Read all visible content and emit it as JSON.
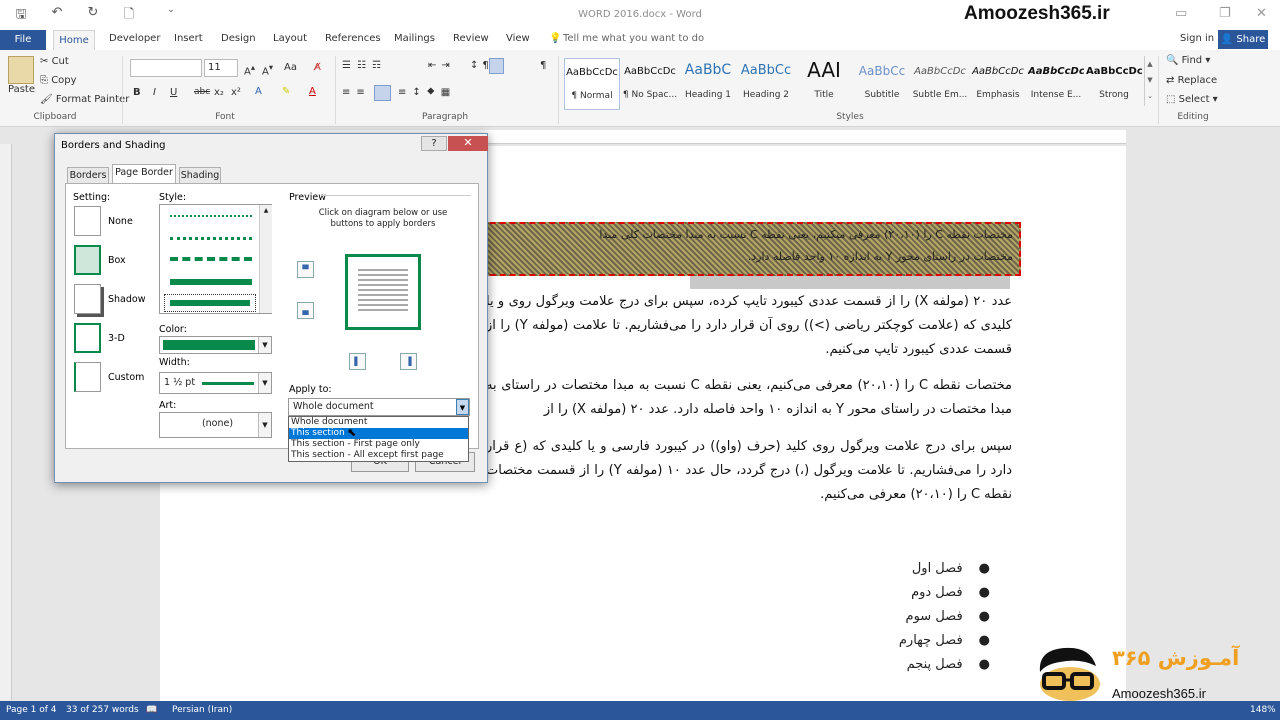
{
  "app": {
    "doc_title": "WORD  2016.docx - Word",
    "brand": "Amoozesh365.ir"
  },
  "tabs": {
    "file": "File",
    "home": "Home",
    "items": [
      "Developer",
      "Insert",
      "Design",
      "Layout",
      "References",
      "Mailings",
      "Review",
      "View"
    ],
    "tell_me": "Tell me what you want to do",
    "sign_in": "Sign in",
    "share": "Share"
  },
  "ribbon": {
    "clipboard": {
      "paste": "Paste",
      "cut": "Cut",
      "copy": "Copy",
      "format_painter": "Format Painter",
      "label": "Clipboard"
    },
    "font": {
      "size": "11",
      "label": "Font",
      "bold": "B",
      "italic": "I",
      "underline": "U",
      "strike": "abc",
      "sub": "x₂",
      "sup": "x²",
      "case": "Aa"
    },
    "paragraph": {
      "label": "Paragraph"
    },
    "styles": {
      "label": "Styles",
      "items": [
        {
          "sample": "AaBbCcDc",
          "name": "¶ Normal"
        },
        {
          "sample": "AaBbCcDc",
          "name": "¶ No Spac..."
        },
        {
          "sample": "AaBbC",
          "name": "Heading 1"
        },
        {
          "sample": "AaBbCc",
          "name": "Heading 2"
        },
        {
          "sample": "AAI",
          "name": "Title"
        },
        {
          "sample": "AaBbCc",
          "name": "Subtitle"
        },
        {
          "sample": "AaBbCcDc",
          "name": "Subtle Em..."
        },
        {
          "sample": "AaBbCcDc",
          "name": "Emphasis"
        },
        {
          "sample": "AaBbCcDc",
          "name": "Intense E..."
        },
        {
          "sample": "AaBbCcDc",
          "name": "Strong"
        }
      ]
    },
    "editing": {
      "find": "Find",
      "replace": "Replace",
      "select": "Select",
      "label": "Editing"
    }
  },
  "document": {
    "highlight_lines": [
      "مختصات نقطه C را (۲۰،۱۰) معرفی میکنیم، یعنی نقطه C نسبت به مبدا مختصات کلی مبدا",
      "مختصات در راستای محور Y به اندازه ۱۰ واحد فاصله دارد."
    ],
    "paragraphs": [
      "عدد ۲۰ (مولفه X) را از قسمت عددی کیبورد تایپ کرده، سپس برای درج علامت ویرگول روی و یا کلیدی که (علامت کوچکتر ریاضی (>)) روی آن قرار دارد را می‌فشاریم. تا علامت (مولفه Y) را از قسمت عددی کیبورد تایپ می‌کنیم.",
      "مختصات نقطه C را (۲۰،۱۰) معرفی می‌کنیم، یعنی نقطه C نسبت به مبدا مختصات در راستای به مبدا مختصات در راستای محور Y به اندازه ۱۰ واحد فاصله دارد. عدد ۲۰ (مولفه X) را از",
      "سپس برای درج علامت ویرگول روی کلید (حرف (واو)) در کیبورد فارسی و یا کلیدی که (ع قرار دارد را می‌فشاریم. تا علامت ویرگول (،) درج گردد، حال عدد ۱۰ (مولفه Y) را از قسمت مختصات نقطه C را (۲۰،۱۰) معرفی می‌کنیم."
    ],
    "bullets": [
      "فصل اول",
      "فصل دوم",
      "فصل سوم",
      "فصل چهارم",
      "فصل پنجم"
    ]
  },
  "dialog": {
    "title": "Borders and Shading",
    "help": "?",
    "close": "✕",
    "tabs": [
      "Borders",
      "Page Border",
      "Shading"
    ],
    "setting_label": "Setting:",
    "settings": [
      "None",
      "Box",
      "Shadow",
      "3-D",
      "Custom"
    ],
    "style_label": "Style:",
    "color_label": "Color:",
    "width_label": "Width:",
    "width_value": "1 ½ pt",
    "art_label": "Art:",
    "art_value": "(none)",
    "preview_label": "Preview",
    "preview_hint": "Click on diagram below or use buttons to apply borders",
    "apply_label": "Apply to:",
    "apply_value": "Whole document",
    "apply_options": [
      "Whole document",
      "This section",
      "This section - First page only",
      "This section - All except first page"
    ],
    "ok": "OK",
    "cancel": "Cancel"
  },
  "status": {
    "page": "Page 1 of 4",
    "words": "33 of 257 words",
    "language": "Persian (Iran)",
    "zoom": "148%"
  },
  "logo": {
    "text_fa": "آمـوزش ۳۶۵",
    "url": "Amoozesh365.ir"
  },
  "colors": {
    "word_blue": "#2b579a",
    "border_green": "#0a8a4a"
  }
}
